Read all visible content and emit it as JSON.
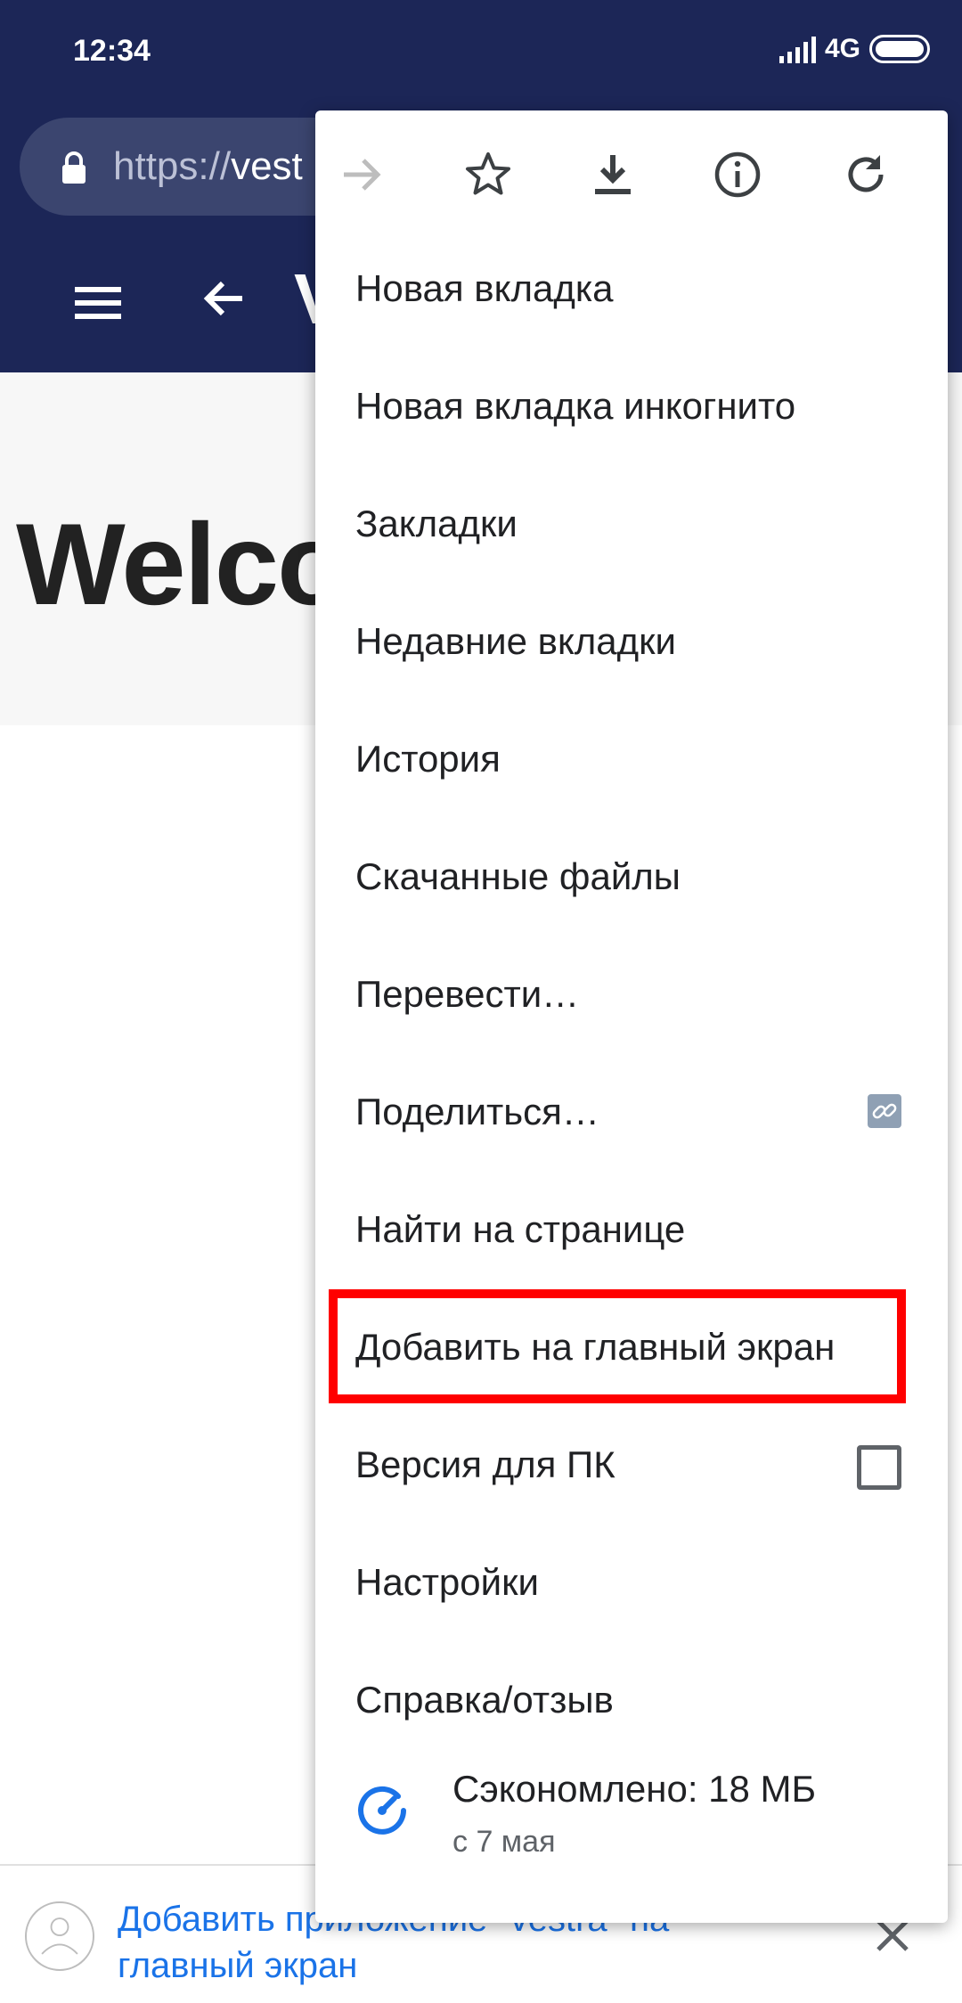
{
  "status_bar": {
    "time": "12:34",
    "network": "4G"
  },
  "browser": {
    "url_prefix": "https://",
    "url_host": "vest"
  },
  "site": {
    "title": "V",
    "hero_text": "Welco"
  },
  "menu": {
    "toolbar_icons": [
      "forward-icon",
      "star-icon",
      "download-icon",
      "info-icon",
      "refresh-icon"
    ],
    "items": [
      {
        "label": "Новая вкладка"
      },
      {
        "label": "Новая вкладка инкогнито"
      },
      {
        "label": "Закладки"
      },
      {
        "label": "Недавние вкладки"
      },
      {
        "label": "История"
      },
      {
        "label": "Скачанные файлы"
      },
      {
        "label": "Перевести…"
      },
      {
        "label": "Поделиться…"
      },
      {
        "label": "Найти на странице"
      },
      {
        "label": "Добавить на главный экран"
      },
      {
        "label": "Версия для ПК"
      },
      {
        "label": "Настройки"
      },
      {
        "label": "Справка/отзыв"
      }
    ],
    "desktop_checkbox_checked": false,
    "saved": {
      "main": "Сэкономлено: 18 МБ",
      "sub": "с 7 мая"
    },
    "highlight_color": "#ff0000"
  },
  "banner": {
    "text": "Добавить приложение \"vestra\" на главный экран"
  },
  "colors": {
    "chrome": "#1c2657",
    "link": "#1a73e8",
    "saved_icon": "#1a73e8"
  }
}
